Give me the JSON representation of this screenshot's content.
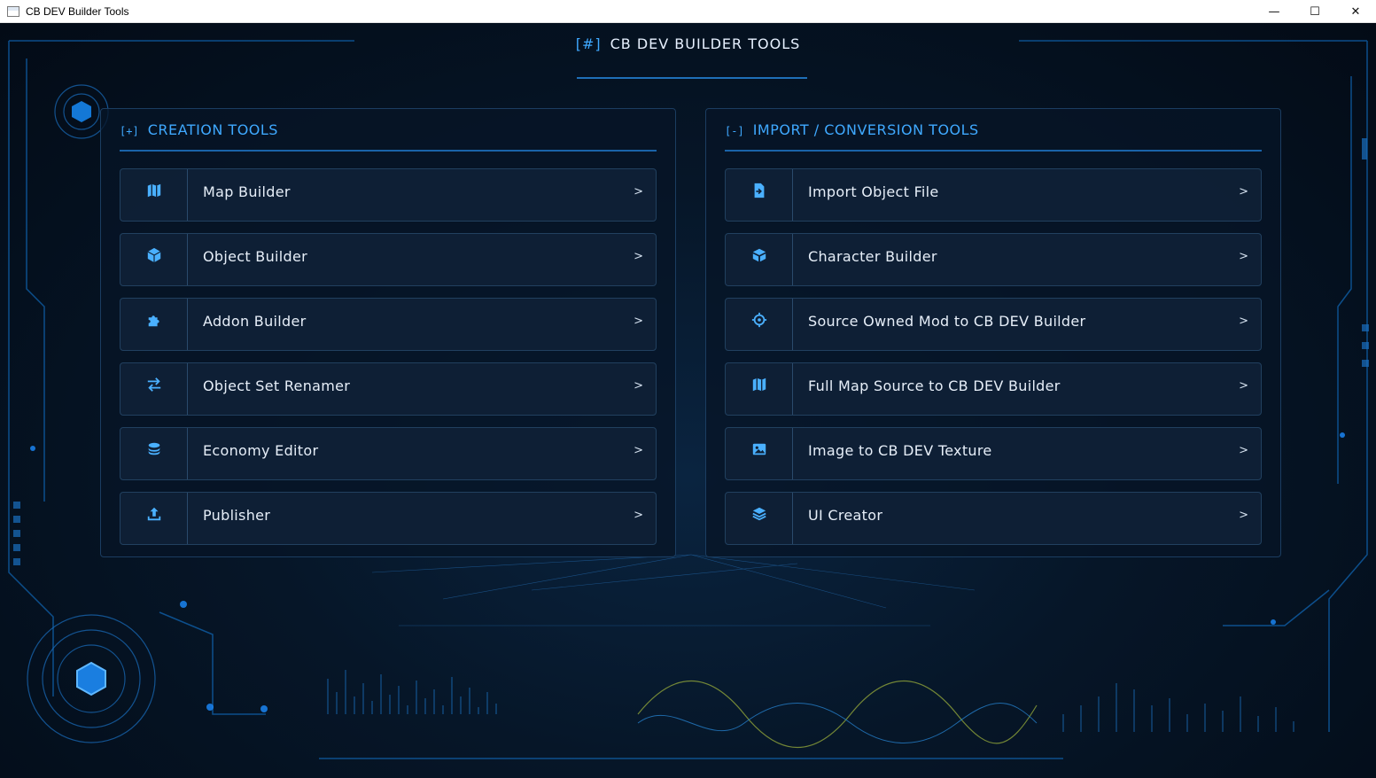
{
  "window": {
    "title": "CB DEV Builder Tools",
    "controls": {
      "minimize": "—",
      "maximize": "☐",
      "close": "✕"
    }
  },
  "header": {
    "tag": "[#]",
    "title": "CB DEV BUILDER TOOLS"
  },
  "panels": {
    "creation": {
      "tag": "[+]",
      "title": "CREATION TOOLS",
      "items": [
        {
          "label": "Map Builder",
          "icon": "map-icon",
          "chevron": ">"
        },
        {
          "label": "Object Builder",
          "icon": "cube-icon",
          "chevron": ">"
        },
        {
          "label": "Addon Builder",
          "icon": "puzzle-icon",
          "chevron": ">"
        },
        {
          "label": "Object Set Renamer",
          "icon": "swap-arrows-icon",
          "chevron": ">"
        },
        {
          "label": "Economy Editor",
          "icon": "coin-stack-icon",
          "chevron": ">"
        },
        {
          "label": "Publisher",
          "icon": "upload-icon",
          "chevron": ">"
        }
      ]
    },
    "import": {
      "tag": "[-]",
      "title": "IMPORT / CONVERSION TOOLS",
      "items": [
        {
          "label": "Import Object File",
          "icon": "file-import-icon",
          "chevron": ">"
        },
        {
          "label": "Character Builder",
          "icon": "box-open-icon",
          "chevron": ">"
        },
        {
          "label": "Source Owned Mod to CB DEV Builder",
          "icon": "crosshair-icon",
          "chevron": ">"
        },
        {
          "label": "Full Map Source to CB DEV Builder",
          "icon": "map-icon",
          "chevron": ">"
        },
        {
          "label": "Image to CB DEV Texture",
          "icon": "image-icon",
          "chevron": ">"
        },
        {
          "label": "UI Creator",
          "icon": "layers-icon",
          "chevron": ">"
        }
      ]
    }
  },
  "colors": {
    "accent": "#3fa9ff",
    "background": "#04101f",
    "panel_border": "#1b3d61",
    "text": "#e6eef8"
  }
}
